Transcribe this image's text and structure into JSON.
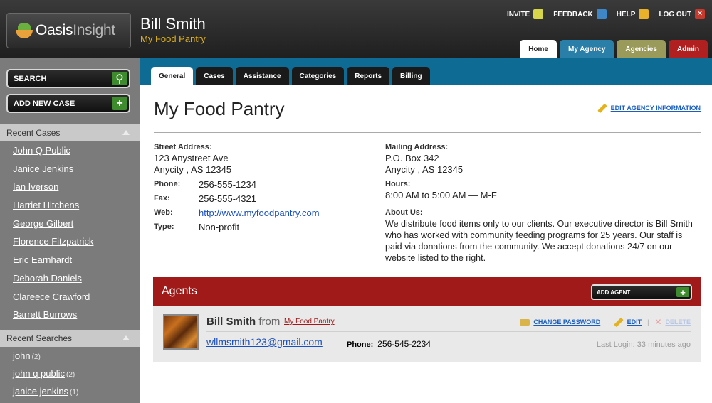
{
  "header": {
    "logo_text_bold": "Oasis",
    "logo_text_light": "Insight",
    "user_name": "Bill Smith",
    "user_org": "My Food Pantry",
    "links": {
      "invite": "INVITE",
      "feedback": "FEEDBACK",
      "help": "HELP",
      "logout": "LOG OUT"
    },
    "tabs": [
      "Home",
      "My Agency",
      "Agencies",
      "Admin"
    ]
  },
  "sidebar": {
    "search_label": "SEARCH",
    "add_case_label": "ADD NEW CASE",
    "recent_cases_title": "Recent Cases",
    "recent_cases": [
      "John Q Public",
      "Janice Jenkins",
      "Ian Iverson",
      "Harriet Hitchens",
      "George Gilbert",
      "Florence Fitzpatrick",
      "Eric Earnhardt",
      "Deborah Daniels",
      "Clareece Crawford",
      "Barrett Burrows"
    ],
    "recent_searches_title": "Recent Searches",
    "recent_searches": [
      {
        "term": "john",
        "count": "(2)"
      },
      {
        "term": "john q public",
        "count": "(2)"
      },
      {
        "term": "janice jenkins",
        "count": "(1)"
      }
    ]
  },
  "subnav": {
    "tabs": [
      "General",
      "Cases",
      "Assistance",
      "Categories",
      "Reports",
      "Billing"
    ]
  },
  "agency": {
    "title": "My Food Pantry",
    "edit_label": "EDIT AGENCY INFORMATION",
    "street_label": "Street Address:",
    "street_line1": "123 Anystreet Ave",
    "street_line2": "Anycity , AS 12345",
    "phone_label": "Phone:",
    "phone": "256-555-1234",
    "fax_label": "Fax:",
    "fax": "256-555-4321",
    "web_label": "Web:",
    "web": "http://www.myfoodpantry.com",
    "type_label": "Type:",
    "type": "Non-profit",
    "mailing_label": "Mailing Address:",
    "mailing_line1": "P.O. Box 342",
    "mailing_line2": "Anycity , AS 12345",
    "hours_label": "Hours:",
    "hours": "8:00 AM to 5:00 AM  —  M-F",
    "about_label": "About Us:",
    "about": "We distribute food items only to our clients. Our executive director is Bill Smith who has worked with community feeding programs for 25 years. Our staff is paid via donations from the community. We accept donations 24/7 on our website listed to the right."
  },
  "agents": {
    "title": "Agents",
    "add_label": "ADD AGENT",
    "items": [
      {
        "name": "Bill Smith",
        "from_label": "from",
        "org": "My Food Pantry",
        "email": "wllmsmith123@gmail.com",
        "phone_label": "Phone:",
        "phone": "256-545-2234",
        "change_password": "CHANGE PASSWORD",
        "edit": "EDIT",
        "delete": "DELETE",
        "last_login": "Last Login: 33 minutes ago"
      }
    ]
  }
}
